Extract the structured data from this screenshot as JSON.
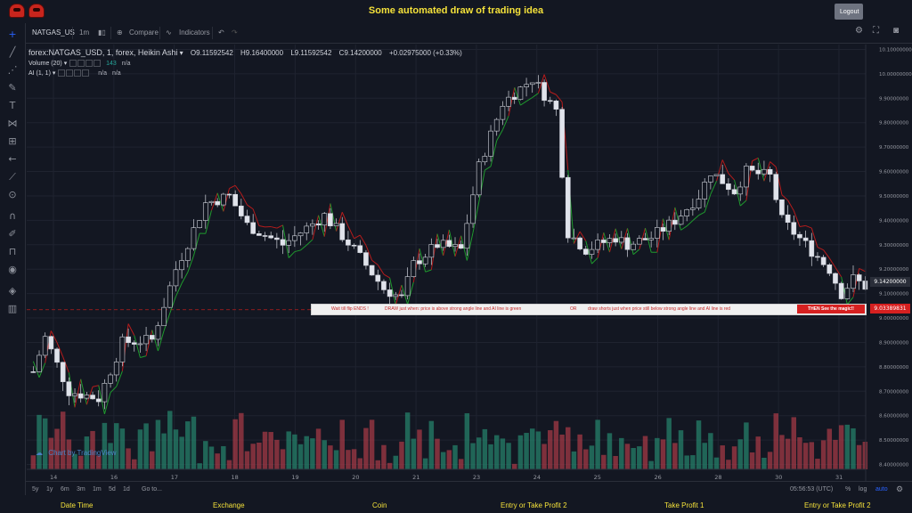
{
  "title": "Some automated draw of trading idea",
  "logout_label": "Logout",
  "toolbar": {
    "symbol": "NATGAS_US",
    "interval": "1m",
    "compare": "Compare",
    "indicators": "Indicators"
  },
  "legend": {
    "main": "forex:NATGAS_USD, 1, forex, Heikin Ashi",
    "open": "O9.11592542",
    "high": "H9.16400000",
    "low": "L9.11592542",
    "close": "C9.14200000",
    "change": "+0.02975000 (+0.33%)",
    "volume_label": "Volume (20)",
    "volume_value": "143",
    "volume_na": "n/a",
    "ai_label": "AI (1, 1)",
    "ai_na1": "n/a",
    "ai_na2": "n/a"
  },
  "annotation": {
    "part1": "Wait till flip ENDS  !",
    "part2": "DRAW just when:  price is above strong angle line and AI line is green",
    "part3": "OR",
    "part4": "draw shorts just when price still below strong angle line and AI line is red",
    "magic": "THEN See the magic!!"
  },
  "watermark": "Chart by TradingView",
  "bottombar": {
    "timeframes": [
      "5y",
      "1y",
      "6m",
      "3m",
      "1m",
      "5d",
      "1d"
    ],
    "goto": "Go to...",
    "clock": "05:56:53 (UTC)",
    "percent": "%",
    "log": "log",
    "auto": "auto"
  },
  "footer": [
    "Date Time",
    "Exchange",
    "Coin",
    "Entry or Take Profit 2",
    "Take Profit 1",
    "Entry or Take Profit 2"
  ],
  "price_labels": {
    "last": "9.14200000",
    "line": "9.03389831"
  },
  "colors": {
    "title": "#f4e13a",
    "background": "#131722",
    "ai_line_green": "#1f9a2e",
    "ai_line_red": "#b71c1c",
    "volume_up": "#26806a",
    "volume_down": "#a33a46",
    "annotation_text": "#c62828"
  },
  "chart_data": {
    "type": "candlestick",
    "style": "Heikin Ashi",
    "symbol": "forex:NATGAS_USD",
    "interval": "1",
    "y_ticks": [
      8.4,
      8.5,
      8.6,
      8.7,
      8.8,
      8.9,
      9.0,
      9.1,
      9.2,
      9.3,
      9.4,
      9.5,
      9.6,
      9.7,
      9.8,
      9.9,
      10.0,
      10.1
    ],
    "y_tick_labels": [
      "8.40000000",
      "8.50000000",
      "8.60000000",
      "8.70000000",
      "8.80000000",
      "8.90000000",
      "9.00000000",
      "9.10000000",
      "9.20000000",
      "9.30000000",
      "9.40000000",
      "9.50000000",
      "9.60000000",
      "9.70000000",
      "9.80000000",
      "9.90000000",
      "10.00000000",
      "10.10000000"
    ],
    "ylim": [
      8.38,
      10.12
    ],
    "x_ticks": [
      "14",
      "16",
      "17",
      "18",
      "19",
      "20",
      "21",
      "23",
      "24",
      "25",
      "26",
      "28",
      "30",
      "31"
    ],
    "horizontal_line": 9.03389831,
    "price_path": [
      [
        0,
        8.78
      ],
      [
        2,
        8.92
      ],
      [
        6,
        8.7
      ],
      [
        11,
        8.67
      ],
      [
        15,
        8.9
      ],
      [
        20,
        8.91
      ],
      [
        24,
        9.2
      ],
      [
        29,
        9.47
      ],
      [
        33,
        9.5
      ],
      [
        36,
        9.38
      ],
      [
        42,
        9.3
      ],
      [
        49,
        9.42
      ],
      [
        54,
        9.28
      ],
      [
        59,
        9.12
      ],
      [
        62,
        9.08
      ],
      [
        64,
        9.22
      ],
      [
        68,
        9.3
      ],
      [
        72,
        9.28
      ],
      [
        75,
        9.62
      ],
      [
        79,
        9.88
      ],
      [
        84,
        9.98
      ],
      [
        88,
        9.85
      ],
      [
        90,
        9.35
      ],
      [
        93,
        9.28
      ],
      [
        98,
        9.33
      ],
      [
        100,
        9.3
      ],
      [
        104,
        9.33
      ],
      [
        108,
        9.4
      ],
      [
        112,
        9.5
      ],
      [
        114,
        9.6
      ],
      [
        118,
        9.52
      ],
      [
        120,
        9.6
      ],
      [
        124,
        9.58
      ],
      [
        126,
        9.4
      ],
      [
        130,
        9.3
      ],
      [
        134,
        9.2
      ],
      [
        136,
        9.1
      ],
      [
        138,
        9.16
      ],
      [
        140,
        9.13
      ]
    ]
  }
}
